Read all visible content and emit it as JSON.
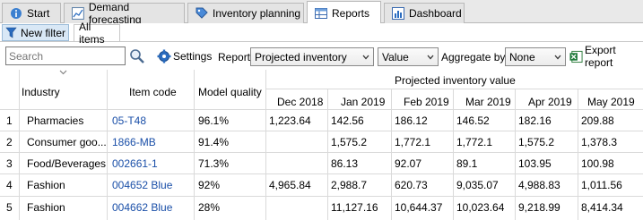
{
  "tabs": [
    {
      "label": "Start",
      "icon": "info-icon"
    },
    {
      "label": "Demand forecasting",
      "icon": "chart-icon"
    },
    {
      "label": "Inventory planning",
      "icon": "tag-icon"
    },
    {
      "label": "Reports",
      "icon": "table-icon",
      "active": true
    },
    {
      "label": "Dashboard",
      "icon": "bar-chart-icon"
    }
  ],
  "subtabs": {
    "filter": "New filter",
    "items": "All items"
  },
  "toolbar": {
    "search_placeholder": "Search",
    "settings_label": "Settings",
    "report_label": "Report",
    "report_value": "Projected inventory",
    "metric_value": "Value",
    "aggregate_label": "Aggregate by",
    "aggregate_value": "None",
    "export_label": "Export report"
  },
  "table": {
    "group_header": "Projected inventory value",
    "columns": [
      "Industry",
      "Item code",
      "Model quality",
      "Dec 2018",
      "Jan 2019",
      "Feb 2019",
      "Mar 2019",
      "Apr 2019",
      "May 2019"
    ],
    "rows": [
      {
        "n": "1",
        "industry": "Pharmacies",
        "item": "05-T48",
        "quality": "96.1%",
        "vals": [
          "1,223.64",
          "142.56",
          "186.12",
          "146.52",
          "182.16",
          "209.88"
        ]
      },
      {
        "n": "2",
        "industry": "Consumer goo...",
        "item": "1866-MB",
        "quality": "91.4%",
        "vals": [
          "",
          "1,575.2",
          "1,772.1",
          "1,772.1",
          "1,575.2",
          "1,378.3"
        ]
      },
      {
        "n": "3",
        "industry": "Food/Beverages",
        "item": "002661-1",
        "quality": "71.3%",
        "vals": [
          "",
          "86.13",
          "92.07",
          "89.1",
          "103.95",
          "100.98"
        ]
      },
      {
        "n": "4",
        "industry": "Fashion",
        "item": "004652 Blue",
        "quality": "92%",
        "vals": [
          "4,965.84",
          "2,988.7",
          "620.73",
          "9,035.07",
          "4,988.83",
          "1,011.56"
        ]
      },
      {
        "n": "5",
        "industry": "Fashion",
        "item": "004662 Blue",
        "quality": "28%",
        "vals": [
          "",
          "11,127.16",
          "10,644.37",
          "10,023.64",
          "9,218.99",
          "8,414.34"
        ]
      }
    ]
  }
}
